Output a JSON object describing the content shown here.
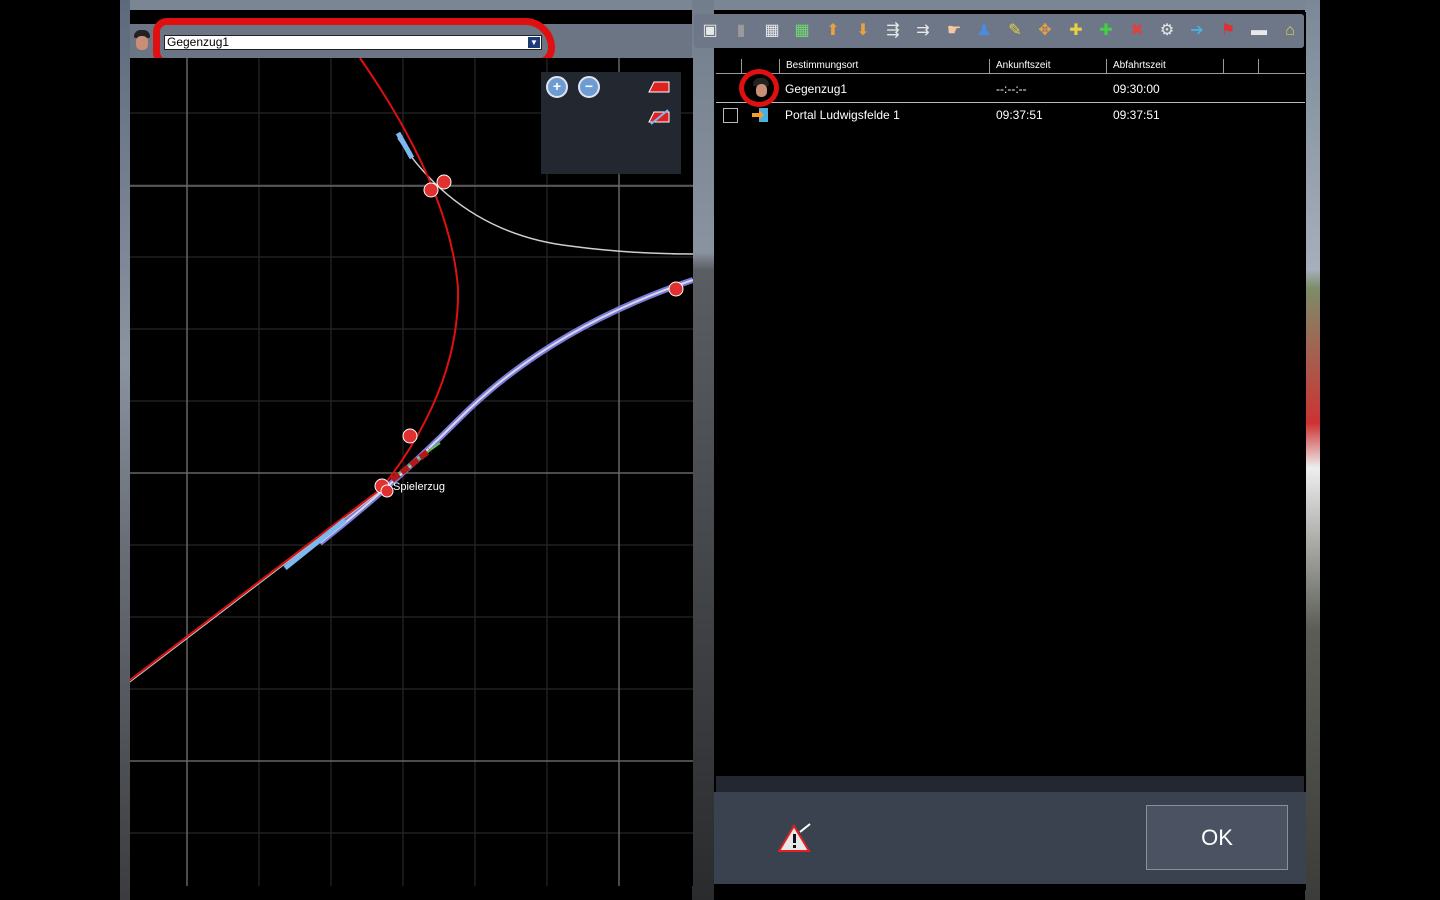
{
  "train_selector": {
    "selected_train": "Gegenzug1"
  },
  "map": {
    "player_train_label": "Spielerzug"
  },
  "timetable": {
    "columns": [
      "Bestimmungsort",
      "Ankunftszeit",
      "Abfahrtszeit"
    ],
    "rows": [
      {
        "destination": "Gegenzug1",
        "arrival": "--:--:--",
        "departure": "09:30:00"
      },
      {
        "destination": "Portal Ludwigsfelde 1",
        "arrival": "09:37:51",
        "departure": "09:37:51"
      }
    ]
  },
  "footer": {
    "ok_label": "OK"
  },
  "icons": [
    "save-icon",
    "delete-icon",
    "grid-icon",
    "grid-green-icon",
    "move-up-icon",
    "move-down-icon",
    "split-icon",
    "join-icon",
    "hand-icon",
    "people-icon",
    "edit-icon",
    "network-icon",
    "add-yellow-icon",
    "add-green-icon",
    "remove-icon",
    "settings-icon",
    "portal-icon",
    "flag-icon",
    "panel-icon",
    "train-icon"
  ],
  "colors": {
    "highlight": "#e01010",
    "route_track": "#e01010",
    "player_track": "#7a7ad8",
    "toolbar": "#6d7787"
  }
}
